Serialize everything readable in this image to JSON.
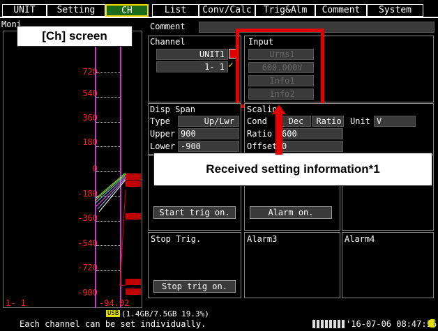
{
  "tabs": [
    "UNIT",
    "Setting",
    "CH",
    "List",
    "Conv/Calc",
    "Trig&Alm",
    "Comment",
    "System"
  ],
  "monitor_label": "Moni",
  "callout_screen": "[Ch] screen",
  "callout_received": "Received setting information*1",
  "y_labels": [
    "720",
    "540",
    "360",
    "180",
    "0",
    "-180",
    "-360",
    "-540",
    "-720",
    "-900"
  ],
  "channel_id": "1- 1",
  "current_value": "-94.02",
  "comment": {
    "label": "Comment",
    "value": ""
  },
  "channel": {
    "label": "Channel",
    "unit": "UNIT1",
    "ch": "1- 1"
  },
  "input": {
    "label": "Input",
    "fields": [
      "Urms1",
      "600.000V",
      "Info1",
      "Info2"
    ]
  },
  "disp_span": {
    "label": "Disp Span",
    "type_label": "Type",
    "type_value": "Up/Lwr",
    "upper_label": "Upper",
    "upper_value": "900",
    "lower_label": "Lower",
    "lower_value": "-900"
  },
  "scaling": {
    "label": "Scaling",
    "cond_label": "Cond",
    "cond_dec": "Dec",
    "cond_ratio": "Ratio",
    "unit_label": "Unit",
    "unit_value": "V",
    "ratio_label": "Ratio",
    "ratio_value": "600",
    "offset_label": "Offset",
    "offset_value": "0"
  },
  "start_trig": "Start trig on.",
  "alarm": "Alarm on.",
  "stop_trig": {
    "label": "Stop Trig.",
    "button": "Stop trig on."
  },
  "alarm3": "Alarm3",
  "alarm4": "Alarm4",
  "storage": "(1.4GB/7.5GB 19.3%)",
  "storage_badge": "USB",
  "help": "Each channel can be set individually.",
  "datetime": "'16-07-06 08:47:16"
}
